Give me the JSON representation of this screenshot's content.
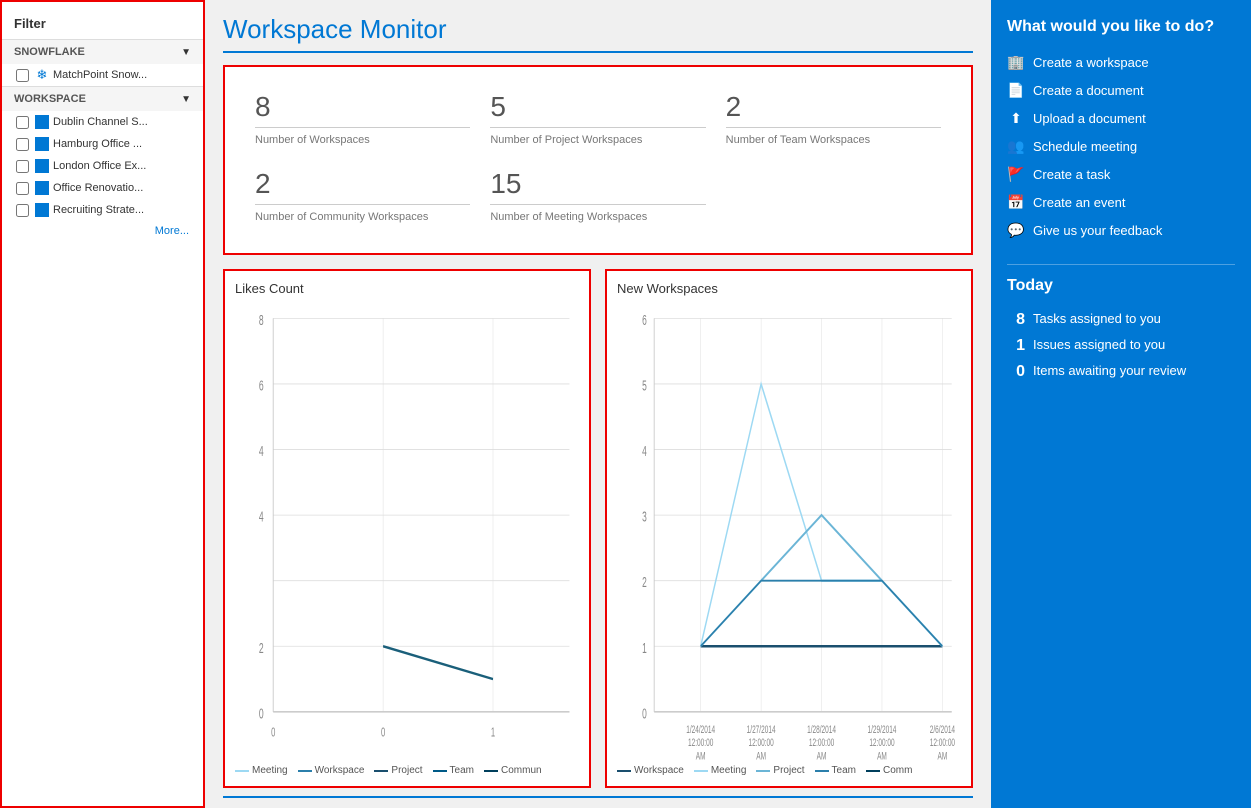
{
  "sidebar": {
    "title": "Filter",
    "snowflake_section": "SNOWFLAKE",
    "workspace_section": "WORKSPACE",
    "snowflake_items": [
      {
        "label": "MatchPoint Snow..."
      }
    ],
    "workspace_items": [
      {
        "label": "Dublin Channel S..."
      },
      {
        "label": "Hamburg Office ..."
      },
      {
        "label": "London Office Ex..."
      },
      {
        "label": "Office Renovatio..."
      },
      {
        "label": "Recruiting Strate..."
      }
    ],
    "more_label": "More..."
  },
  "main": {
    "title": "Workspace Monitor",
    "stats": [
      {
        "number": "8",
        "label": "Number of Workspaces"
      },
      {
        "number": "5",
        "label": "Number of Project Workspaces"
      },
      {
        "number": "2",
        "label": "Number of Team Workspaces"
      },
      {
        "number": "2",
        "label": "Number of Community Workspaces"
      },
      {
        "number": "15",
        "label": "Number of Meeting Workspaces"
      }
    ],
    "charts": [
      {
        "title": "Likes Count",
        "legend": [
          {
            "label": "Meeting",
            "color": "#9dd9f3"
          },
          {
            "label": "Workspace",
            "color": "#2b7fab"
          },
          {
            "label": "Project",
            "color": "#1a4f6e"
          },
          {
            "label": "Team",
            "color": "#005a87"
          },
          {
            "label": "Commun",
            "color": "#003f5c"
          }
        ]
      },
      {
        "title": "New Workspaces",
        "legend": [
          {
            "label": "Workspace",
            "color": "#1a4f6e"
          },
          {
            "label": "Meeting",
            "color": "#9dd9f3"
          },
          {
            "label": "Project",
            "color": "#2b7fab"
          },
          {
            "label": "Team",
            "color": "#005a87"
          },
          {
            "label": "Comm",
            "color": "#003f5c"
          }
        ],
        "x_labels": [
          "1/24/2014\n12:00:00\nAM",
          "1/27/2014\n12:00:00\nAM",
          "1/28/2014\n12:00:00\nAM",
          "1/29/2014\n12:00:00\nAM",
          "2/6/2014\n12:00:00\nAM"
        ]
      }
    ]
  },
  "right_panel": {
    "what_title": "What would you like to do?",
    "actions": [
      {
        "label": "Create a workspace",
        "icon": "🏢"
      },
      {
        "label": "Create a document",
        "icon": "📄"
      },
      {
        "label": "Upload a document",
        "icon": "⬆"
      },
      {
        "label": "Schedule meeting",
        "icon": "👥"
      },
      {
        "label": "Create a task",
        "icon": "🚩"
      },
      {
        "label": "Create an event",
        "icon": "📅"
      },
      {
        "label": "Give us your feedback",
        "icon": "💬"
      }
    ],
    "today_title": "Today",
    "today_items": [
      {
        "count": "8",
        "label": "Tasks assigned to you"
      },
      {
        "count": "1",
        "label": "Issues assigned to you"
      },
      {
        "count": "0",
        "label": "Items awaiting your review"
      }
    ]
  }
}
